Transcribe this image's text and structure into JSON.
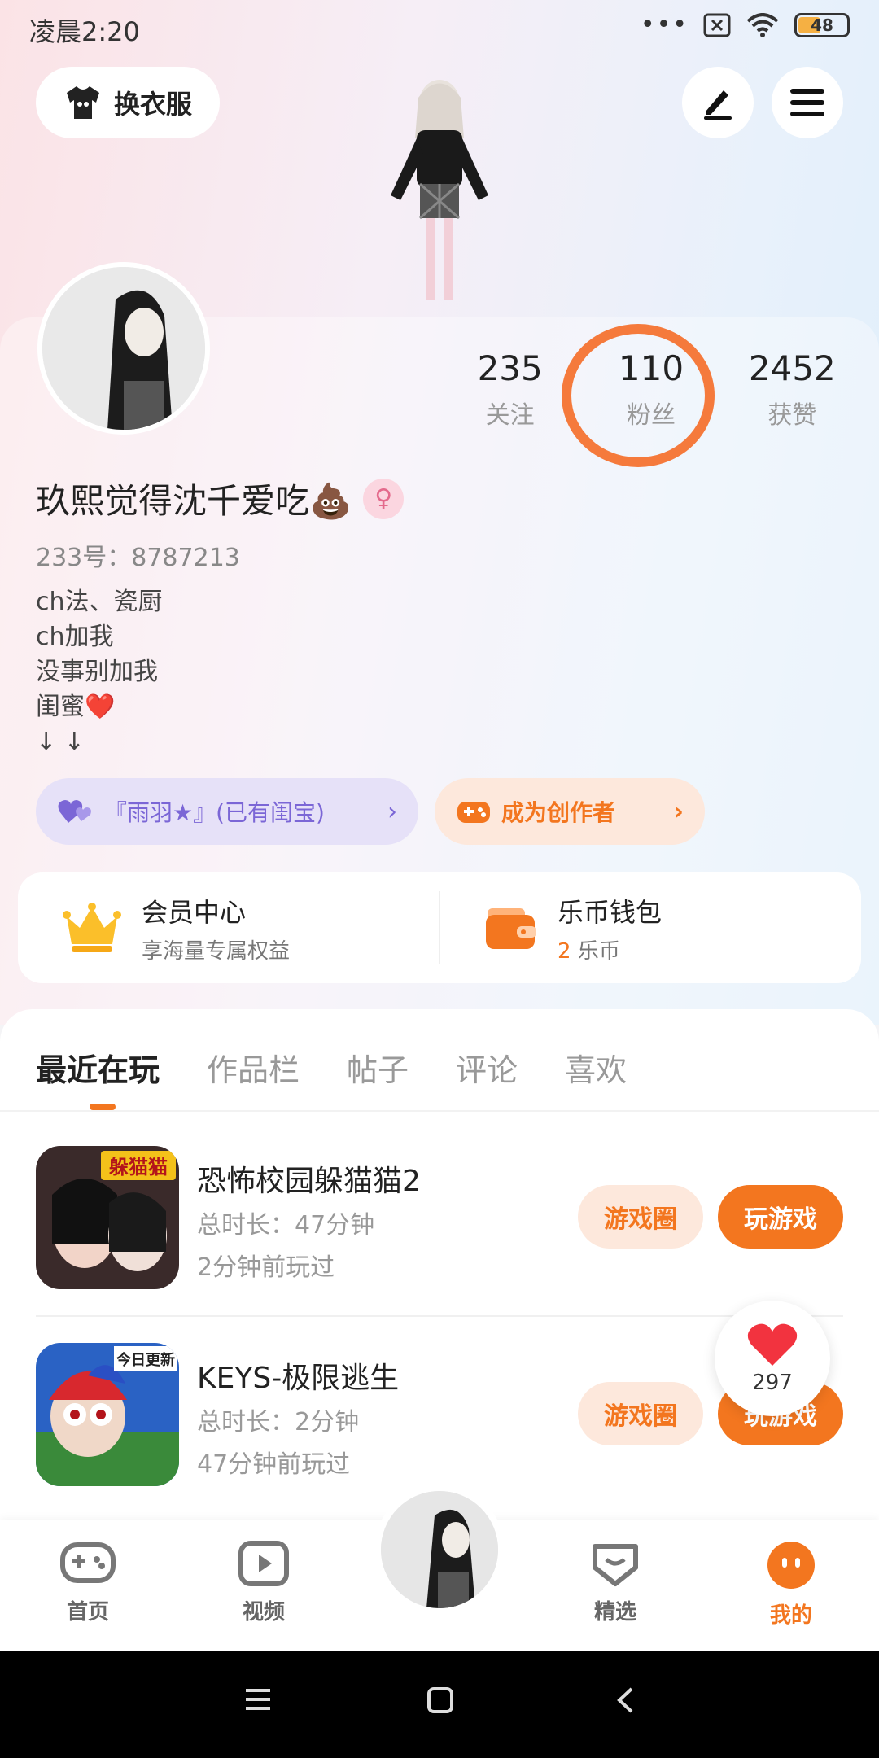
{
  "status_bar": {
    "time": "凌晨2:20",
    "battery": "48",
    "dots": "•••"
  },
  "header": {
    "outfit_label": "换衣服"
  },
  "profile": {
    "stats": [
      {
        "value": "235",
        "label": "关注"
      },
      {
        "value": "110",
        "label": "粉丝"
      },
      {
        "value": "2452",
        "label": "获赞"
      }
    ],
    "nickname": "玖熙觉得沈千爱吃💩",
    "gender_symbol": "♀",
    "uid": "233号：8787213",
    "bio": [
      "ch法、瓷厨",
      "ch加我",
      "没事别加我",
      "闺蜜❤️",
      "↓ ↓"
    ],
    "tags": {
      "bestie": "『雨羽★』(已有闺宝)",
      "creator": "成为创作者"
    }
  },
  "cards": {
    "vip": {
      "title": "会员中心",
      "subtitle": "享海量专属权益"
    },
    "wallet": {
      "title": "乐币钱包",
      "amount": "2",
      "unit": "乐币"
    }
  },
  "tabs": [
    "最近在玩",
    "作品栏",
    "帖子",
    "评论",
    "喜欢"
  ],
  "games": [
    {
      "title": "恐怖校园躲猫猫2",
      "duration": "总时长：47分钟",
      "last_played": "2分钟前玩过",
      "icon_label": "躲猫猫"
    },
    {
      "title": "KEYS-极限逃生",
      "duration": "总时长：2分钟",
      "last_played": "47分钟前玩过",
      "icon_label": "今日更新"
    }
  ],
  "game_buttons": {
    "circle": "游戏圈",
    "play": "玩游戏"
  },
  "like_float": {
    "count": "297"
  },
  "bottom_nav": [
    {
      "label": "首页"
    },
    {
      "label": "视频"
    },
    {
      "label": "精选"
    },
    {
      "label": "我的"
    }
  ],
  "colors": {
    "accent": "#f3761f",
    "highlight_ring": "#f57a3c",
    "purple_tag": "#7b66d6"
  }
}
